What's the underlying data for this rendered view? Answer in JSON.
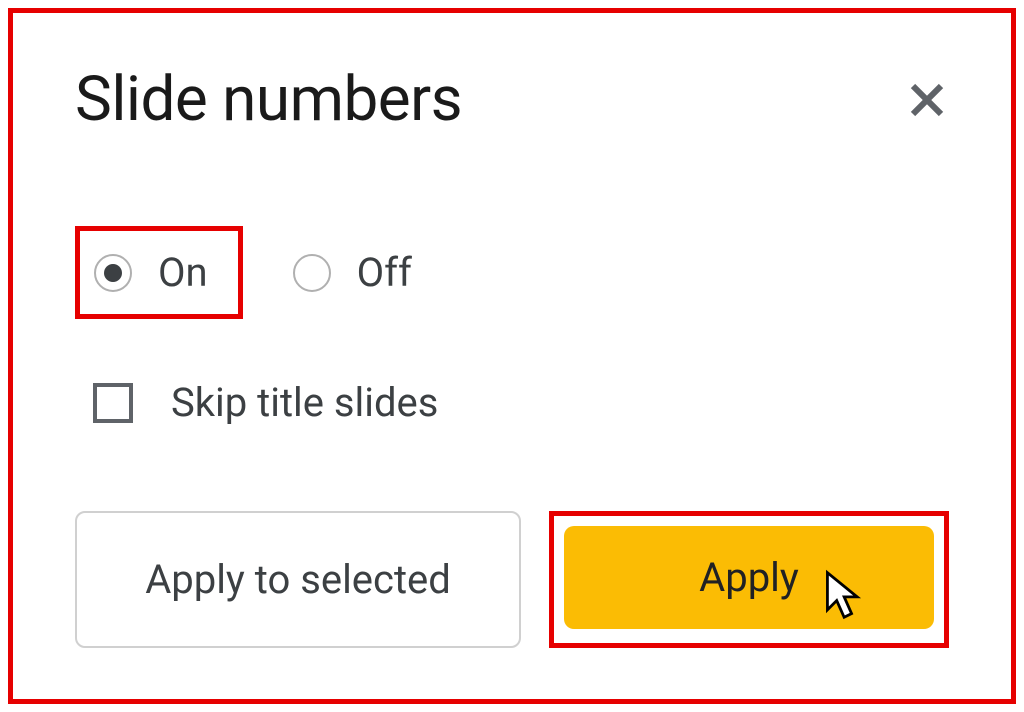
{
  "dialog": {
    "title": "Slide numbers",
    "radio": {
      "on_label": "On",
      "off_label": "Off",
      "selected": "on"
    },
    "checkbox": {
      "skip_title_label": "Skip title slides",
      "checked": false
    },
    "buttons": {
      "apply_selected_label": "Apply to selected",
      "apply_label": "Apply"
    }
  },
  "highlights": {
    "outer_color": "#e60000",
    "on_option_highlighted": true,
    "apply_button_highlighted": true
  },
  "colors": {
    "primary_button": "#fbbc04",
    "text": "#3c4043",
    "border": "#d0d0d0"
  }
}
